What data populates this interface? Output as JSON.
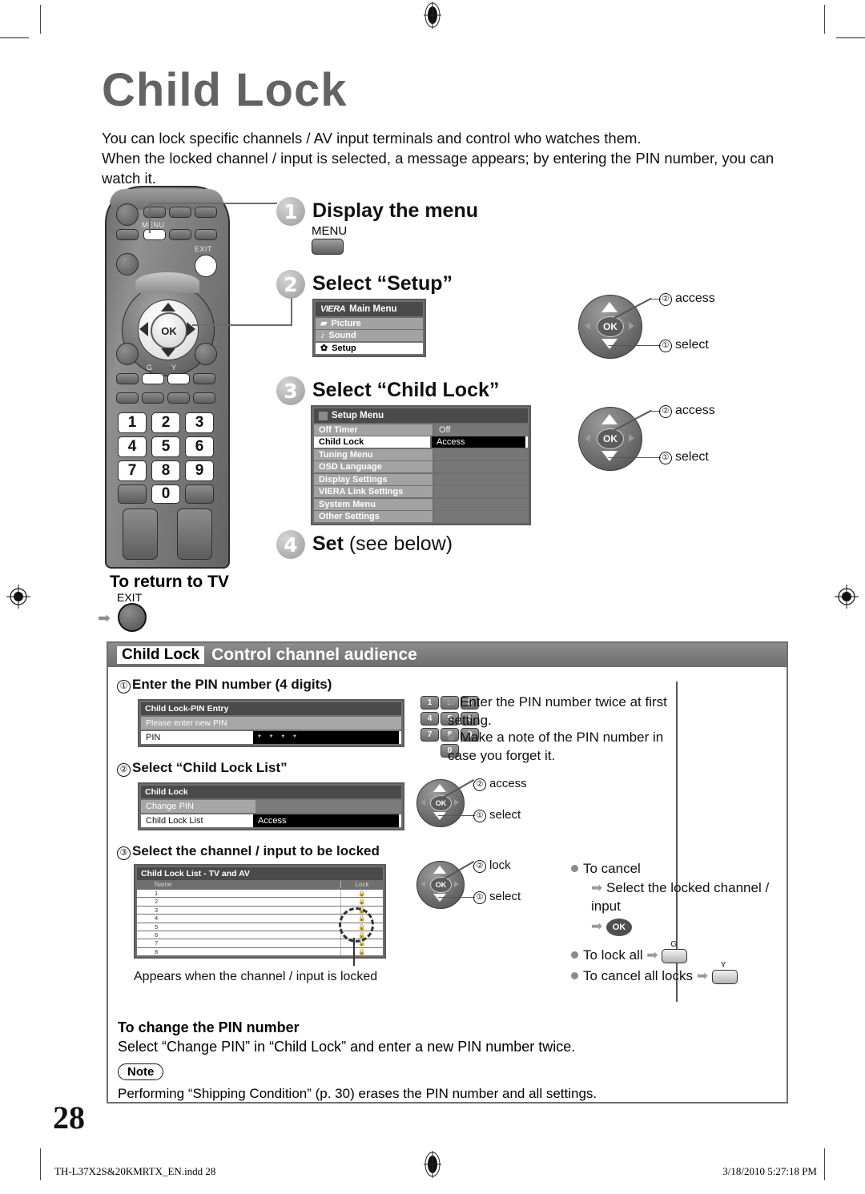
{
  "page": {
    "title": "Child Lock",
    "intro": "You can lock specific channels / AV input terminals and control who watches them.\nWhen the locked channel / input is selected, a message appears; by entering the PIN number, you can watch it.",
    "number": "28",
    "footer_left": "TH-L37X2S&20KMRTX_EN.indd   28",
    "footer_right": "3/18/2010   5:27:18 PM"
  },
  "remote": {
    "menu_label": "MENU",
    "exit_label": "EXIT",
    "ok_label": "OK",
    "green_label": "G",
    "yellow_label": "Y",
    "keys": [
      "1",
      "2",
      "3",
      "4",
      "5",
      "6",
      "7",
      "8",
      "9",
      "0"
    ]
  },
  "steps": [
    {
      "num": "1",
      "title": "Display the menu",
      "button_label": "MENU"
    },
    {
      "num": "2",
      "title": "Select “Setup”"
    },
    {
      "num": "3",
      "title": "Select “Child Lock”"
    },
    {
      "num": "4",
      "title": "Set",
      "suffix": "(see below)"
    }
  ],
  "main_menu": {
    "logo": "VIERA",
    "title": "Main Menu",
    "items": [
      {
        "label": "Picture",
        "selected": false
      },
      {
        "label": "Sound",
        "selected": false
      },
      {
        "label": "Setup",
        "selected": true
      }
    ]
  },
  "setup_menu": {
    "title": "Setup Menu",
    "rows": [
      {
        "label": "Off Timer",
        "value": "Off",
        "selected": false
      },
      {
        "label": "Child Lock",
        "value": "Access",
        "selected": true
      },
      {
        "label": "Tuning Menu",
        "value": "",
        "selected": false
      },
      {
        "label": "OSD Language",
        "value": "",
        "selected": false
      },
      {
        "label": "Display Settings",
        "value": "",
        "selected": false
      },
      {
        "label": "VIERA Link Settings",
        "value": "",
        "selected": false
      },
      {
        "label": "System Menu",
        "value": "",
        "selected": false
      },
      {
        "label": "Other Settings",
        "value": "",
        "selected": false
      }
    ]
  },
  "wheels": {
    "access_label": "access",
    "select_label": "select",
    "lock_label": "lock",
    "num_one": "①",
    "num_two": "②",
    "ok": "OK"
  },
  "return_to_tv": {
    "heading": "To return to TV",
    "exit_label": "EXIT"
  },
  "section": {
    "tag": "Child Lock",
    "title": "Control channel audience",
    "substeps": [
      {
        "num": "①",
        "text": "Enter the PIN number (4 digits)"
      },
      {
        "num": "②",
        "text": "Select “Child Lock List”"
      },
      {
        "num": "③",
        "text": "Select the channel / input to be locked"
      }
    ],
    "pin_dialog": {
      "title": "Child Lock-PIN Entry",
      "message": "Please enter new PIN",
      "field_label": "PIN",
      "field_value": "* * * *"
    },
    "child_lock_menu": {
      "title": "Child Lock",
      "rows": [
        {
          "label": "Change PIN",
          "value": "",
          "selected": false
        },
        {
          "label": "Child Lock List",
          "value": "Access",
          "selected": true
        }
      ]
    },
    "lock_list": {
      "title": "Child Lock List - TV and AV",
      "col_name": "Name",
      "col_lock": "Lock",
      "rows": [
        "1",
        "2",
        "3",
        "4",
        "5",
        "6",
        "7",
        "8"
      ]
    },
    "caption": "Appears when the channel / input is locked",
    "notes_pin": [
      "Enter the PIN number twice at first setting.",
      "Make a note of the PIN number in case you forget it."
    ],
    "notes_cancel": {
      "to_cancel": "To cancel",
      "cancel_step1": "Select the locked channel / input",
      "cancel_ok": "OK",
      "lock_all": "To lock all",
      "lock_all_key": "G",
      "cancel_all": "To cancel all locks",
      "cancel_all_key": "Y"
    },
    "change_pin_heading": "To change the PIN number",
    "change_pin_text": "Select “Change PIN” in “Child Lock” and enter a new PIN number twice.",
    "note_badge": "Note",
    "note_text": "Performing “Shipping Condition” (p. 30) erases the PIN number and all settings."
  },
  "keypad_icons": [
    "1",
    "2",
    "3",
    "4",
    "5",
    "6",
    "7",
    "8",
    "9",
    "0"
  ]
}
